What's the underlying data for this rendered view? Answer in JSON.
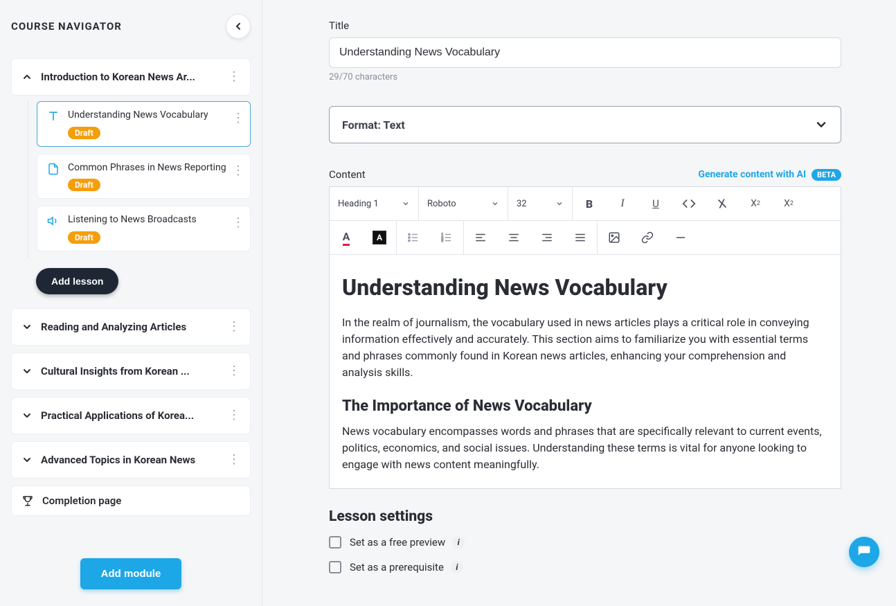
{
  "sidebar": {
    "title": "COURSE NAVIGATOR",
    "modules": [
      {
        "title": "Introduction to Korean News Ar...",
        "expanded": true
      },
      {
        "title": "Reading and Analyzing Articles",
        "expanded": false
      },
      {
        "title": "Cultural Insights from Korean ...",
        "expanded": false
      },
      {
        "title": "Practical Applications of Korea...",
        "expanded": false
      },
      {
        "title": "Advanced Topics in Korean News",
        "expanded": false
      }
    ],
    "lessons": [
      {
        "title": "Understanding News Vocabulary",
        "badge": "Draft",
        "icon": "text",
        "active": true
      },
      {
        "title": "Common Phrases in News Reporting",
        "badge": "Draft",
        "icon": "pdf",
        "active": false
      },
      {
        "title": "Listening to News Broadcasts",
        "badge": "Draft",
        "icon": "audio",
        "active": false
      }
    ],
    "add_lesson_label": "Add lesson",
    "completion_label": "Completion page",
    "add_module_label": "Add module"
  },
  "main": {
    "title_label": "Title",
    "title_value": "Understanding News Vocabulary",
    "char_count": "29/70 characters",
    "format_label": "Format: Text",
    "content_label": "Content",
    "ai_link": "Generate content with AI",
    "beta_label": "BETA",
    "toolbar": {
      "style": "Heading 1",
      "font": "Roboto",
      "size": "32"
    },
    "doc": {
      "h1": "Understanding News Vocabulary",
      "p1": "In the realm of journalism, the vocabulary used in news articles plays a critical role in conveying information effectively and accurately. This section aims to familiarize you with essential terms and phrases commonly found in Korean news articles, enhancing your comprehension and analysis skills.",
      "h2": "The Importance of News Vocabulary",
      "p2": "News vocabulary encompasses words and phrases that are specifically relevant to current events, politics, economics, and social issues. Understanding these terms is vital for anyone looking to engage with news content meaningfully."
    },
    "settings": {
      "heading": "Lesson settings",
      "free_preview": "Set as a free preview",
      "prerequisite": "Set as a prerequisite"
    }
  }
}
